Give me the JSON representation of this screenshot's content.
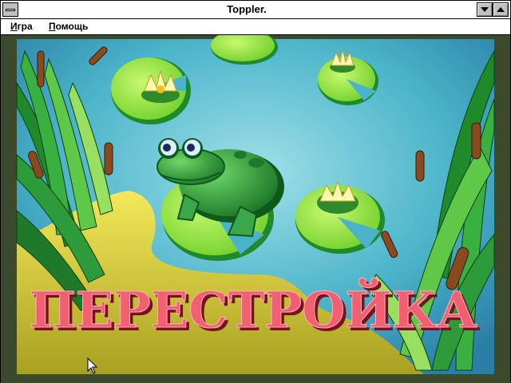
{
  "window": {
    "title": "Toppler."
  },
  "menu": {
    "items": [
      {
        "first": "И",
        "rest": "гра"
      },
      {
        "first": "П",
        "rest": "омощь"
      }
    ]
  },
  "scene": {
    "headline": "ПЕРЕСТРОЙКА"
  },
  "colors": {
    "water": "#4ab3c9",
    "sand": "#e8d84a",
    "frog": "#2e9b3a",
    "lily_pad": "#8fe03a",
    "headline": "#f06070"
  }
}
